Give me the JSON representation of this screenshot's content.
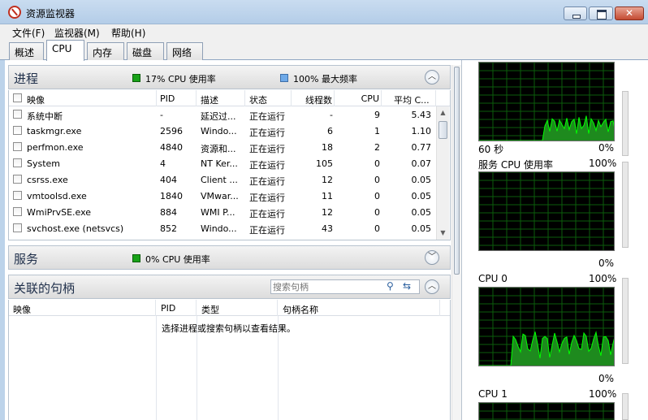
{
  "window": {
    "title": "资源监视器"
  },
  "menu": [
    "文件(F)",
    "监视器(M)",
    "帮助(H)"
  ],
  "tabs": [
    "概述",
    "CPU",
    "内存",
    "磁盘",
    "网络"
  ],
  "processes": {
    "title": "进程",
    "cpu_usage": "17% CPU 使用率",
    "max_freq": "100% 最大频率",
    "columns": [
      "映像",
      "PID",
      "描述",
      "状态",
      "线程数",
      "CPU",
      "平均 C..."
    ],
    "rows": [
      {
        "image": "系统中断",
        "pid": "-",
        "desc": "延迟过...",
        "status": "正在运行",
        "threads": "-",
        "cpu": "9",
        "avg": "5.43"
      },
      {
        "image": "taskmgr.exe",
        "pid": "2596",
        "desc": "Windo...",
        "status": "正在运行",
        "threads": "6",
        "cpu": "1",
        "avg": "1.10"
      },
      {
        "image": "perfmon.exe",
        "pid": "4840",
        "desc": "资源和...",
        "status": "正在运行",
        "threads": "18",
        "cpu": "2",
        "avg": "0.77"
      },
      {
        "image": "System",
        "pid": "4",
        "desc": "NT Ker...",
        "status": "正在运行",
        "threads": "105",
        "cpu": "0",
        "avg": "0.07"
      },
      {
        "image": "csrss.exe",
        "pid": "404",
        "desc": "Client ...",
        "status": "正在运行",
        "threads": "12",
        "cpu": "0",
        "avg": "0.05"
      },
      {
        "image": "vmtoolsd.exe",
        "pid": "1840",
        "desc": "VMwar...",
        "status": "正在运行",
        "threads": "11",
        "cpu": "0",
        "avg": "0.05"
      },
      {
        "image": "WmiPrvSE.exe",
        "pid": "884",
        "desc": "WMI P...",
        "status": "正在运行",
        "threads": "12",
        "cpu": "0",
        "avg": "0.05"
      },
      {
        "image": "svchost.exe (netsvcs)",
        "pid": "852",
        "desc": "Windo...",
        "status": "正在运行",
        "threads": "43",
        "cpu": "0",
        "avg": "0.05"
      }
    ]
  },
  "services": {
    "title": "服务",
    "cpu_usage": "0% CPU 使用率"
  },
  "handles": {
    "title": "关联的句柄",
    "search_placeholder": "搜索句柄",
    "columns": [
      "映像",
      "PID",
      "类型",
      "句柄名称"
    ],
    "empty_message": "选择进程或搜索句柄以查看结果。"
  },
  "graphs": {
    "g1": {
      "time": "60 秒",
      "pct": "0%"
    },
    "g2": {
      "title": "服务 CPU 使用率",
      "top": "100%",
      "bottom": "0%"
    },
    "g3": {
      "title": "CPU 0",
      "top": "100%",
      "bottom": "0%"
    },
    "g4": {
      "title": "CPU 1",
      "top": "100%"
    }
  },
  "colors": {
    "graph_line": "#00ff00",
    "graph_fill": "#1e8a1e",
    "graph_grid": "#0b5d0b"
  }
}
